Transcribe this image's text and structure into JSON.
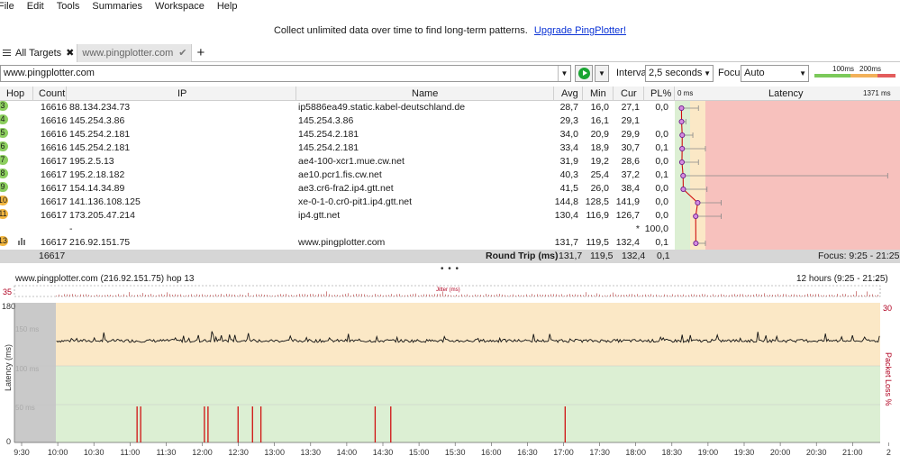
{
  "menu": [
    "File",
    "Edit",
    "Tools",
    "Summaries",
    "Workspace",
    "Help"
  ],
  "promo": {
    "text": "Collect unlimited data over time to find long-term patterns.",
    "link": "Upgrade PingPlotter!"
  },
  "tabs": {
    "all_targets": "All Targets",
    "close": "✖",
    "target": "www.pingplotter.com",
    "check": "✔",
    "add": "+"
  },
  "toolbar": {
    "address": "www.pingplotter.com",
    "interval_label": "Interval",
    "interval_value": "2,5 seconds",
    "focus_label": "Focus",
    "focus_value": "Auto",
    "scale_100": "100ms",
    "scale_200": "200ms",
    "colors": {
      "good": "#7bc95a",
      "warn": "#f2b15a",
      "bad": "#e35d5d"
    }
  },
  "grid": {
    "headers": {
      "hop": "Hop",
      "count": "Count",
      "ip": "IP",
      "name": "Name",
      "avg": "Avg",
      "min": "Min",
      "cur": "Cur",
      "pl": "PL%",
      "lat_start": "0 ms",
      "latency": "Latency",
      "lat_end": "1371 ms"
    },
    "rows": [
      {
        "hop": "3",
        "badge": "green",
        "count": "16616",
        "ip": "88.134.234.73",
        "name": "ip5886ea49.static.kabel-deutschland.de",
        "avg": "28,7",
        "min": "16,0",
        "cur": "27,1",
        "pl": "0,0",
        "lat": 28.7,
        "latmin": 16.0,
        "latmax": 150
      },
      {
        "hop": "4",
        "badge": "green",
        "count": "16616",
        "ip": "145.254.3.86",
        "name": "145.254.3.86",
        "avg": "29,3",
        "min": "16,1",
        "cur": "29,1",
        "pl": "",
        "lat": 29.3,
        "latmin": 16.1,
        "latmax": 60
      },
      {
        "hop": "5",
        "badge": "green",
        "count": "16616",
        "ip": "145.254.2.181",
        "name": "145.254.2.181",
        "avg": "34,0",
        "min": "20,9",
        "cur": "29,9",
        "pl": "0,0",
        "lat": 34.0,
        "latmin": 20.9,
        "latmax": 110
      },
      {
        "hop": "6",
        "badge": "green",
        "count": "16616",
        "ip": "145.254.2.181",
        "name": "145.254.2.181",
        "avg": "33,4",
        "min": "18,9",
        "cur": "30,7",
        "pl": "0,1",
        "lat": 33.4,
        "latmin": 18.9,
        "latmax": 200
      },
      {
        "hop": "7",
        "badge": "green",
        "count": "16617",
        "ip": "195.2.5.13",
        "name": "ae4-100-xcr1.mue.cw.net",
        "avg": "31,9",
        "min": "19,2",
        "cur": "28,6",
        "pl": "0,0",
        "lat": 31.9,
        "latmin": 19.2,
        "latmax": 150
      },
      {
        "hop": "8",
        "badge": "green",
        "count": "16617",
        "ip": "195.2.18.182",
        "name": "ae10.pcr1.fis.cw.net",
        "avg": "40,3",
        "min": "25,4",
        "cur": "37,2",
        "pl": "0,1",
        "lat": 40.3,
        "latmin": 25.4,
        "latmax": 1350
      },
      {
        "hop": "9",
        "badge": "green",
        "count": "16617",
        "ip": "154.14.34.89",
        "name": "ae3.cr6-fra2.ip4.gtt.net",
        "avg": "41,5",
        "min": "26,0",
        "cur": "38,4",
        "pl": "0,0",
        "lat": 41.5,
        "latmin": 26.0,
        "latmax": 210
      },
      {
        "hop": "10",
        "badge": "orange",
        "count": "16617",
        "ip": "141.136.108.125",
        "name": "xe-0-1-0.cr0-pit1.ip4.gtt.net",
        "avg": "144,8",
        "min": "128,5",
        "cur": "141,9",
        "pl": "0,0",
        "lat": 144.8,
        "latmin": 128.5,
        "latmax": 300
      },
      {
        "hop": "11",
        "badge": "orange",
        "count": "16617",
        "ip": "173.205.47.214",
        "name": "ip4.gtt.net",
        "avg": "130,4",
        "min": "116,9",
        "cur": "126,7",
        "pl": "0,0",
        "lat": 130.4,
        "latmin": 116.9,
        "latmax": 300
      },
      {
        "hop": "",
        "badge": "",
        "count": "",
        "ip": "-",
        "name": "",
        "avg": "",
        "min": "",
        "cur": "*",
        "pl": "100,0",
        "lat": null
      },
      {
        "hop": "13",
        "badge": "orange",
        "count": "16617",
        "ip": "216.92.151.75",
        "name": "www.pingplotter.com",
        "avg": "131,7",
        "min": "119,5",
        "cur": "132,4",
        "pl": "0,1",
        "lat": 131.7,
        "latmin": 119.5,
        "latmax": 200
      }
    ],
    "roundtrip": {
      "count": "16617",
      "label": "Round Trip (ms)",
      "avg": "131,7",
      "min": "119,5",
      "cur": "132,4",
      "pl": "0,1",
      "focus": "Focus: 9:25 - 21:25"
    }
  },
  "timeline": {
    "title": "www.pingplotter.com (216.92.151.75) hop 13",
    "range": "12 hours (9:25 - 21:25)",
    "jitter_label": "Jitter (ms)",
    "jitter_max": "35",
    "y_axis_label": "Latency (ms)",
    "y_right_label": "Packet Loss %",
    "y_right_max": "30",
    "y_ticks": [
      "180",
      "150 ms",
      "100 ms",
      "50 ms",
      "0"
    ],
    "x_ticks": [
      "9:30",
      "10:00",
      "10:30",
      "11:00",
      "11:30",
      "12:00",
      "12:30",
      "13:00",
      "13:30",
      "14:00",
      "14:30",
      "15:00",
      "15:30",
      "16:00",
      "16:30",
      "17:00",
      "17:30",
      "18:00",
      "18:30",
      "19:00",
      "19:30",
      "20:00",
      "20:30",
      "21:00",
      "2"
    ]
  },
  "chart_data": {
    "type": "line",
    "title": "",
    "xlabel": "",
    "ylabel": "Latency (ms)",
    "ylim": [
      0,
      180
    ],
    "x_range": [
      "9:25",
      "21:25"
    ],
    "series": [],
    "baseline_latency_ms": 131,
    "packet_loss_events": [
      "11:07",
      "11:10",
      "12:03",
      "12:06",
      "12:31",
      "12:43",
      "12:50",
      "14:25",
      "14:38",
      "17:03"
    ]
  }
}
